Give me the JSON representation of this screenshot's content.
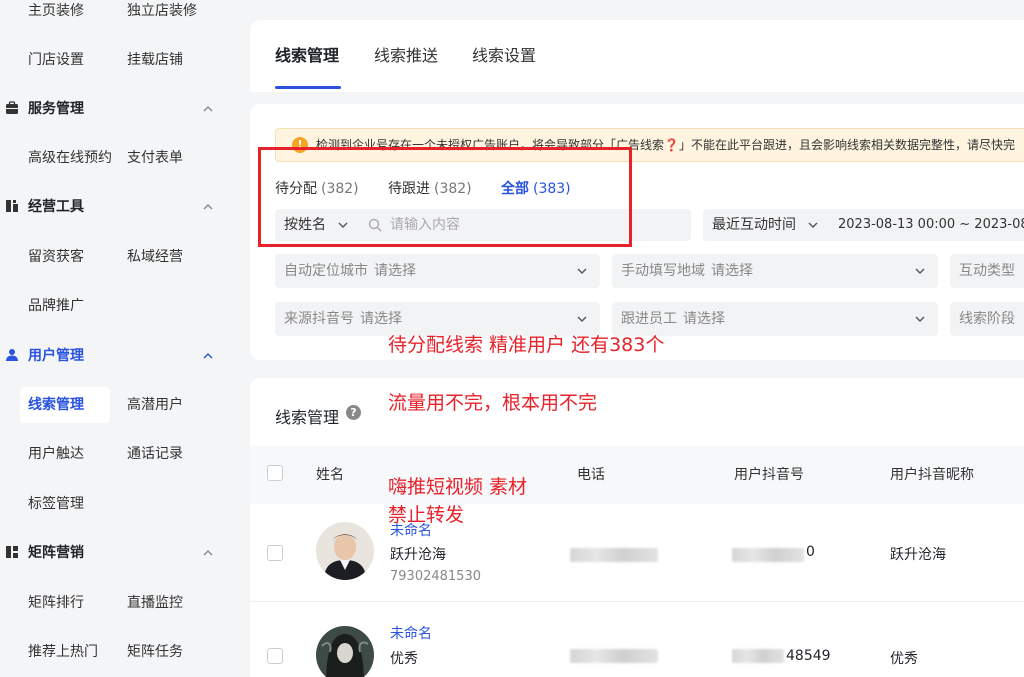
{
  "sidebar": {
    "rows": [
      {
        "left": "主页装修",
        "right": "独立店装修"
      },
      {
        "left": "门店设置",
        "right": "挂载店铺"
      }
    ],
    "sections": [
      {
        "label": "服务管理",
        "icon": "briefcase-icon",
        "items": [
          {
            "left": "高级在线预约",
            "right": "支付表单"
          }
        ]
      },
      {
        "label": "经营工具",
        "icon": "tools-icon",
        "items": [
          {
            "left": "留资获客",
            "right": "私域经营"
          },
          {
            "left": "品牌推广",
            "right": ""
          }
        ]
      },
      {
        "label": "用户管理",
        "icon": "user-icon",
        "items": [
          {
            "left": "线索管理",
            "right": "高潜用户"
          },
          {
            "left": "用户触达",
            "right": "通话记录"
          },
          {
            "left": "标签管理",
            "right": ""
          }
        ]
      },
      {
        "label": "矩阵营销",
        "icon": "grid-icon",
        "items": [
          {
            "left": "矩阵排行",
            "right": "直播监控"
          },
          {
            "left": "推荐上热门",
            "right": "矩阵任务"
          }
        ]
      }
    ]
  },
  "tabs": [
    "线索管理",
    "线索推送",
    "线索设置"
  ],
  "notice": "检测到企业号存在一个未授权广告账户，将会导致部分「广告线索❓」不能在此平台跟进，且会影响线索相关数据完整性，请尽快完",
  "status_tabs": [
    {
      "label": "待分配",
      "count": "(382)"
    },
    {
      "label": "待跟进",
      "count": "(382)"
    },
    {
      "label": "全部",
      "count": "(383)"
    }
  ],
  "search": {
    "by": "按姓名",
    "placeholder": "请输入内容"
  },
  "date_filter": {
    "label": "最近互动时间",
    "range": "2023-08-13 00:00 ~ 2023-08-"
  },
  "filters": {
    "row1": [
      {
        "label": "自动定位城市",
        "placeholder": "请选择"
      },
      {
        "label": "手动填写地域",
        "placeholder": "请选择"
      },
      {
        "label": "互动类型",
        "placeholder": ""
      }
    ],
    "row2": [
      {
        "label": "来源抖音号",
        "placeholder": "请选择"
      },
      {
        "label": "跟进员工",
        "placeholder": "请选择"
      },
      {
        "label": "线索阶段",
        "placeholder": ""
      }
    ]
  },
  "annotations": {
    "a1": "待分配线索 精准用户 还有383个",
    "a2": "流量用不完，根本用不完",
    "a3_line1": "嗨推短视频 素材",
    "a3_line2": "禁止转发"
  },
  "table": {
    "title": "线索管理",
    "columns": [
      "姓名",
      "电话",
      "用户抖音号",
      "用户抖音昵称"
    ],
    "rows": [
      {
        "name_link": "未命名",
        "name": "跃升沧海",
        "id": "79302481530",
        "douyin_suffix": "0",
        "nickname": "跃升沧海"
      },
      {
        "name_link": "未命名",
        "name": "优秀",
        "id": "",
        "douyin_suffix": "48549",
        "nickname": "优秀"
      }
    ]
  },
  "colors": {
    "accent": "#2a53e2",
    "annotation": "#e8222a",
    "notice_bg": "#fff4e0"
  }
}
